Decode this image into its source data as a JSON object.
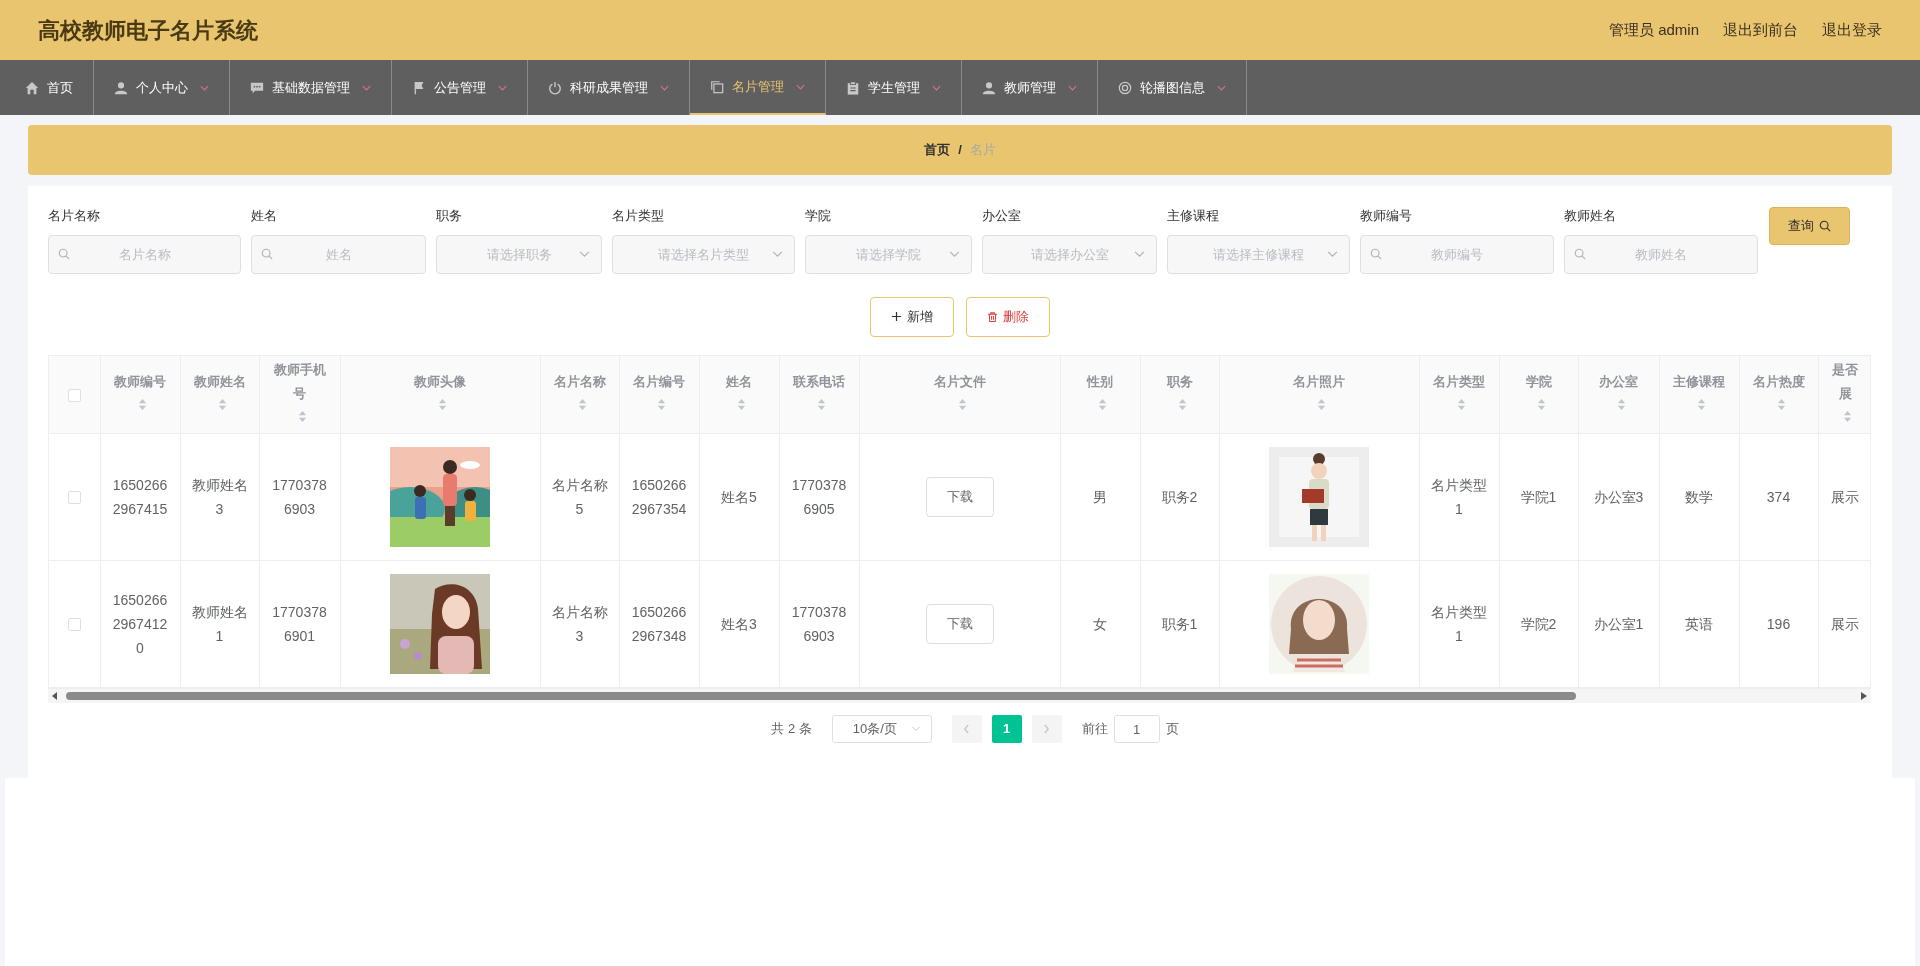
{
  "header": {
    "title": "高校教师电子名片系统",
    "links": [
      "管理员 admin",
      "退出到前台",
      "退出登录"
    ]
  },
  "nav": [
    {
      "label": "首页",
      "dropdown": false,
      "selected": false
    },
    {
      "label": "个人中心",
      "dropdown": true,
      "selected": false
    },
    {
      "label": "基础数据管理",
      "dropdown": true,
      "selected": false
    },
    {
      "label": "公告管理",
      "dropdown": true,
      "selected": false
    },
    {
      "label": "科研成果管理",
      "dropdown": true,
      "selected": false
    },
    {
      "label": "名片管理",
      "dropdown": true,
      "selected": true
    },
    {
      "label": "学生管理",
      "dropdown": true,
      "selected": false
    },
    {
      "label": "教师管理",
      "dropdown": true,
      "selected": false
    },
    {
      "label": "轮播图信息",
      "dropdown": true,
      "selected": false
    }
  ],
  "breadcrumb": {
    "items": [
      {
        "text": "首页",
        "current": false
      },
      {
        "text": "名片",
        "current": true
      }
    ],
    "separator": "/"
  },
  "filters": [
    {
      "label": "名片名称",
      "kind": "search",
      "placeholder": "名片名称"
    },
    {
      "label": "姓名",
      "kind": "search",
      "placeholder": "姓名"
    },
    {
      "label": "职务",
      "kind": "select",
      "placeholder": "请选择职务"
    },
    {
      "label": "名片类型",
      "kind": "select",
      "placeholder": "请选择名片类型"
    },
    {
      "label": "学院",
      "kind": "select",
      "placeholder": "请选择学院"
    },
    {
      "label": "办公室",
      "kind": "select",
      "placeholder": "请选择办公室"
    },
    {
      "label": "主修课程",
      "kind": "select",
      "placeholder": "请选择主修课程"
    },
    {
      "label": "教师编号",
      "kind": "search",
      "placeholder": "教师编号"
    },
    {
      "label": "教师姓名",
      "kind": "search",
      "placeholder": "教师姓名"
    }
  ],
  "query_button": "查询",
  "actions": [
    {
      "label": "新增",
      "kind": "add"
    },
    {
      "label": "删除",
      "kind": "delete"
    }
  ],
  "table": {
    "select_all_checked": false,
    "columns": [
      {
        "label": "教师编号",
        "kind": "text"
      },
      {
        "label": "教师姓名",
        "kind": "text"
      },
      {
        "label": "教师手机号",
        "kind": "text"
      },
      {
        "label": "教师头像",
        "kind": "picture"
      },
      {
        "label": "名片名称",
        "kind": "text"
      },
      {
        "label": "名片编号",
        "kind": "text"
      },
      {
        "label": "姓名",
        "kind": "text"
      },
      {
        "label": "联系电话",
        "kind": "text"
      },
      {
        "label": "名片文件",
        "kind": "button"
      },
      {
        "label": "性别",
        "kind": "text"
      },
      {
        "label": "职务",
        "kind": "text"
      },
      {
        "label": "名片照片",
        "kind": "picture"
      },
      {
        "label": "名片类型",
        "kind": "text"
      },
      {
        "label": "学院",
        "kind": "text"
      },
      {
        "label": "办公室",
        "kind": "text"
      },
      {
        "label": "主修课程",
        "kind": "text"
      },
      {
        "label": "名片热度",
        "kind": "text"
      },
      {
        "label": "是否展",
        "kind": "text"
      }
    ],
    "rows": [
      {
        "checked": false,
        "cells": [
          "16502662967415",
          "教师姓名3",
          "17703786903",
          {
            "kind": "picture"
          },
          "名片名称5",
          "16502662967354",
          "姓名5",
          "17703786905",
          "下载",
          "男",
          "职务2",
          {
            "kind": "picture"
          },
          "名片类型1",
          "学院1",
          "办公室3",
          "数学",
          "374",
          "展示"
        ]
      },
      {
        "checked": false,
        "cells": [
          "165026629674120",
          "教师姓名1",
          "17703786901",
          {
            "kind": "picture"
          },
          "名片名称3",
          "16502662967348",
          "姓名3",
          "17703786903",
          "下载",
          "女",
          "职务1",
          {
            "kind": "picture"
          },
          "名片类型1",
          "学院2",
          "办公室1",
          "英语",
          "196",
          "展示"
        ]
      }
    ]
  },
  "pagination": {
    "total": "共 2 条",
    "page_size": "10条/页",
    "pages": [
      {
        "label": "1",
        "selected": true
      }
    ],
    "goto_label": "前往",
    "goto_value": "1",
    "goto_suffix": "页"
  }
}
